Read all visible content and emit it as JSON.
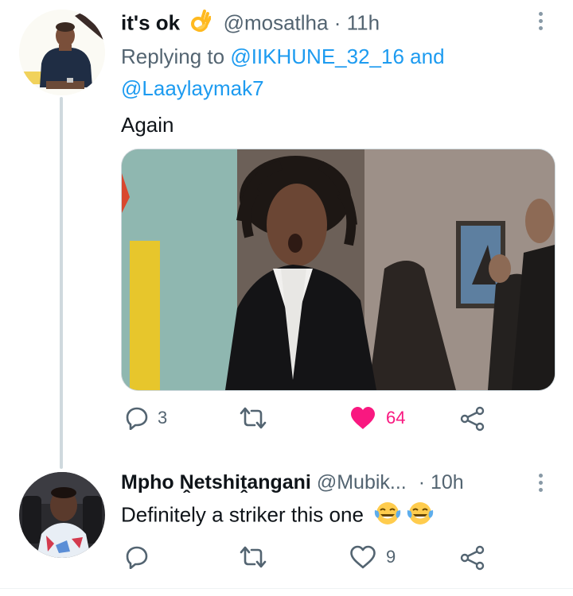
{
  "tweet1": {
    "display_name": "it's ok",
    "name_emoji": "ok-hand-icon",
    "handle": "@mosatlha",
    "separator": "·",
    "time": "11h",
    "replying_to_prefix": "Replying to",
    "reply_user1": "@IIKHUNE_32_16",
    "reply_and": "and",
    "reply_user2": "@Laaylaymak7",
    "text": "Again",
    "actions": {
      "reply_count": "3",
      "retweet_count": "",
      "like_count": "64",
      "liked": true
    }
  },
  "tweet2": {
    "display_name": "Mpho Ṋetshiṱangani",
    "handle": "@Mubik...",
    "separator": "·",
    "time": "10h",
    "text": "Definitely a striker this one",
    "text_emoji": [
      "face-with-tears-of-joy-icon",
      "face-with-tears-of-joy-icon"
    ],
    "actions": {
      "reply_count": "",
      "retweet_count": "",
      "like_count": "9",
      "liked": false
    }
  },
  "colors": {
    "link": "#1d9bf0",
    "muted": "#536471",
    "like_active": "#f91880",
    "thread_line": "#cfd9de"
  }
}
